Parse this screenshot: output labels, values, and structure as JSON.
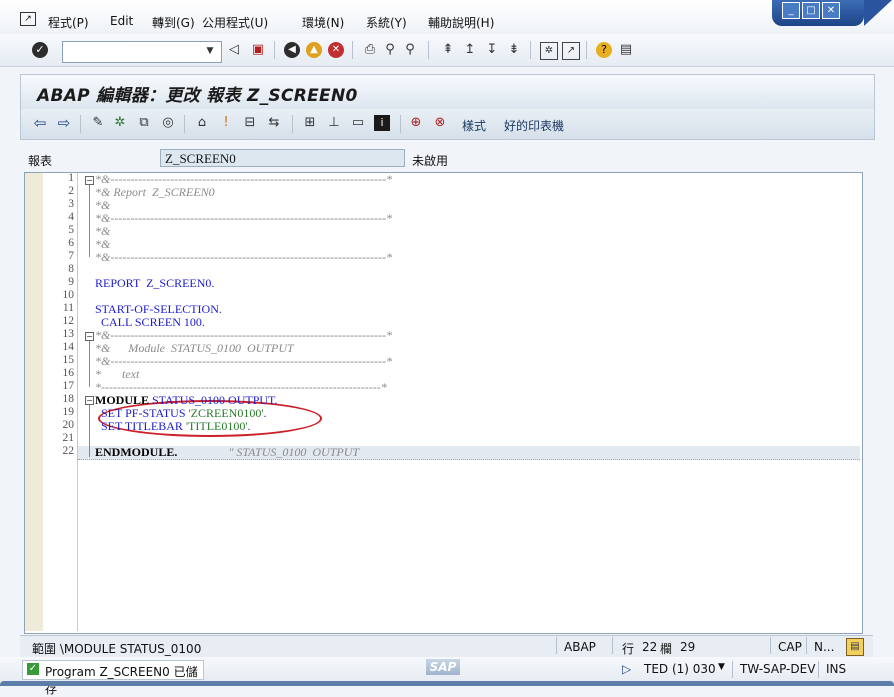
{
  "menu": [
    {
      "label": "程式(P)"
    },
    {
      "label": "Edit"
    },
    {
      "label": "轉到(G)"
    },
    {
      "label": "公用程式(U)"
    },
    {
      "label": "環境(N)"
    },
    {
      "label": "系統(Y)"
    },
    {
      "label": "輔助說明(H)"
    }
  ],
  "command_field": {
    "value": ""
  },
  "title": "ABAP 編輯器：更改 報表 Z_SCREEN0",
  "app_toolbar": {
    "style_label": "樣式",
    "pretty_printer_label": "好的印表機"
  },
  "program": {
    "label": "報表",
    "name": "Z_SCREEN0",
    "status": "未啟用"
  },
  "editor": {
    "line_numbers": [
      "1",
      "2",
      "3",
      "4",
      "5",
      "6",
      "7",
      "8",
      "9",
      "10",
      "11",
      "12",
      "13",
      "14",
      "15",
      "16",
      "17",
      "18",
      "19",
      "20",
      "21",
      "22"
    ],
    "lines": [
      "*&---------------------------------------------------------------------*",
      "*& Report  Z_SCREEN0",
      "*&",
      "*&---------------------------------------------------------------------*",
      "*&",
      "*&",
      "*&---------------------------------------------------------------------*",
      "",
      "REPORT  Z_SCREEN0.",
      "",
      "START-OF-SELECTION.",
      "  CALL SCREEN 100.",
      "*&---------------------------------------------------------------------*",
      "*&      Module  STATUS_0100  OUTPUT",
      "*&---------------------------------------------------------------------*",
      "*       text",
      "*----------------------------------------------------------------------*",
      "MODULE STATUS_0100 OUTPUT.",
      "  SET PF-STATUS 'ZCREEN0100'.",
      "  SET TITLEBAR 'TITLE0100'.",
      "",
      "ENDMODULE.                 \" STATUS_0100  OUTPUT"
    ]
  },
  "editor_status": {
    "scope": "範圍 \\MODULE STATUS_0100",
    "language": "ABAP",
    "line_label": "行",
    "line": "22",
    "col_label": "欄",
    "col": "29",
    "caps": "CAP",
    "num": "N..."
  },
  "statusbar": {
    "message": "Program Z_SCREEN0 已儲存",
    "logo": "SAP",
    "session": "TED (1) 030",
    "server": "TW-SAP-DEV",
    "mode": "INS"
  },
  "colors": {
    "keyword": "#1b1bd0",
    "comment": "#8a8a8a",
    "string": "#2a7a2a",
    "highlight_ellipse": "#cc1f28",
    "accent": "#1d4488"
  }
}
